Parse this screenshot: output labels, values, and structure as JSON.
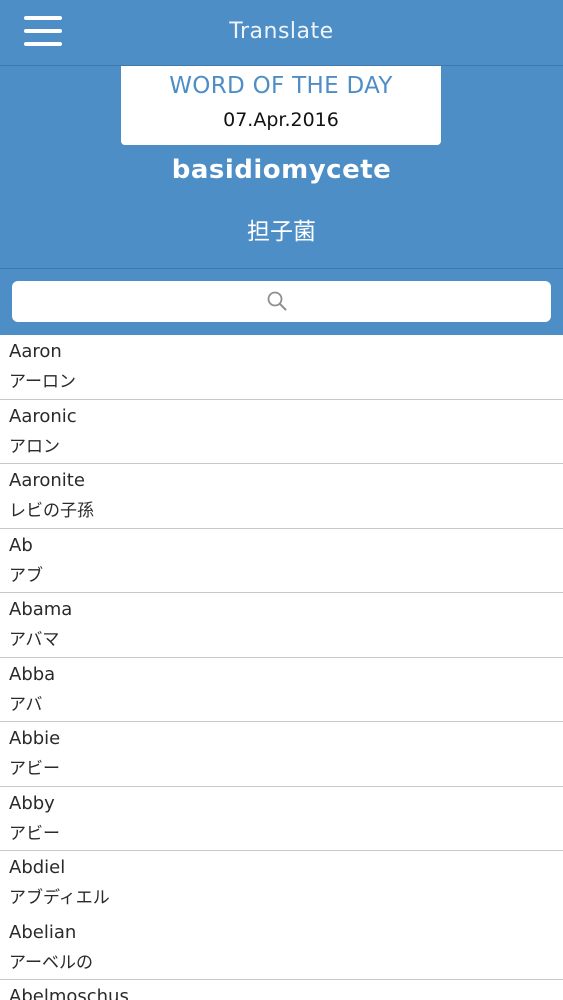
{
  "header": {
    "title": "Translate",
    "menu_icon": "hamburger-menu-icon"
  },
  "word_of_the_day": {
    "heading": "WORD OF THE DAY",
    "date": "07.Apr.2016",
    "word": "basidiomycete",
    "translation": "担子菌"
  },
  "search": {
    "placeholder": "",
    "value": "",
    "icon": "search-icon"
  },
  "colors": {
    "accent": "#4e8ec7",
    "divider": "#c8c8c8"
  },
  "entries": [
    {
      "en": "Aaron",
      "ja": "アーロン"
    },
    {
      "en": "Aaronic",
      "ja": "アロン"
    },
    {
      "en": "Aaronite",
      "ja": "レビの子孫"
    },
    {
      "en": "Ab",
      "ja": "アブ"
    },
    {
      "en": "Abama",
      "ja": "アバマ"
    },
    {
      "en": "Abba",
      "ja": "アバ"
    },
    {
      "en": "Abbie",
      "ja": "アビー"
    },
    {
      "en": "Abby",
      "ja": "アビー"
    },
    {
      "en": "Abdiel",
      "ja": "アブディエル"
    },
    {
      "en": "Abelian",
      "ja": "アーベルの"
    },
    {
      "en": "Abelmoschus",
      "ja": ""
    }
  ]
}
